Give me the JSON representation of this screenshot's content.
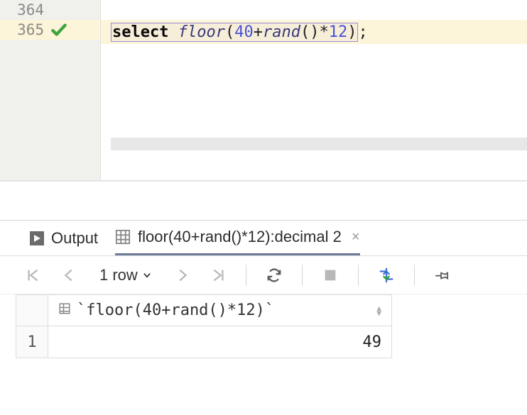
{
  "editor": {
    "lines": [
      {
        "num": "364",
        "checked": false,
        "highlight": false
      },
      {
        "num": "365",
        "checked": true,
        "highlight": true
      }
    ],
    "code": {
      "keyword": "select",
      "func1": "floor",
      "open": "(",
      "lit1": "40",
      "plus": "+",
      "func2": "rand",
      "parens": "()",
      "star": "*",
      "lit2": "12",
      "close": ");"
    }
  },
  "tabs": {
    "output_label": "Output",
    "result_label": "floor(40+rand()*12):decimal 2"
  },
  "toolbar": {
    "row_count_label": "1 row"
  },
  "table": {
    "header": "`floor(40+rand()*12)`",
    "row_index": "1",
    "value": "49"
  }
}
